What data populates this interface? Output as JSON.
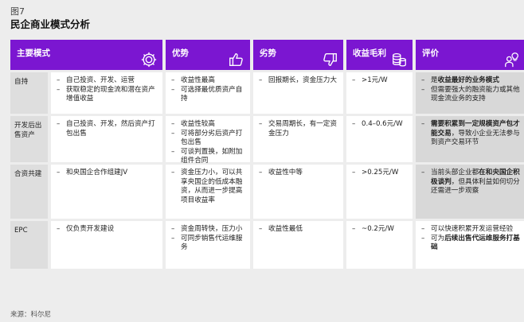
{
  "figure_label": "图7",
  "title": "民企商业模式分析",
  "source": "来源：科尔尼",
  "headers": {
    "mode": "主要模式",
    "pros": "优势",
    "cons": "劣势",
    "margin": "收益毛利",
    "eval": "评价"
  },
  "icons": {
    "mode": "gear-icon",
    "pros": "thumbs-up-icon",
    "cons": "thumbs-down-icon",
    "margin": "coins-icon",
    "eval": "person-idea-icon"
  },
  "colors": {
    "header_bg": "#7b16d1",
    "row_label_bg": "#dedede",
    "cell_bg": "#ffffff",
    "highlight_bg": "#d8d8d8"
  },
  "rows": [
    {
      "label": "自持",
      "mode": [
        "自己投资、开发、运营",
        "获取稳定的现金流和潜在资产增值收益"
      ],
      "pros": [
        "收益性最高",
        "可选择最优质资产自持"
      ],
      "cons": [
        "回报期长，资金压力大"
      ],
      "margin": [
        ">1元/W"
      ],
      "eval_1_pre": "是",
      "eval_1_bold": "收益最好的业务模式",
      "eval_2": "但需要强大的融资能力或其他现金流业务的支持"
    },
    {
      "label": "开发后出售资产",
      "mode": [
        "自己投资、开发，然后资产打包出售"
      ],
      "pros": [
        "收益性较高",
        "可将部分劣后资产打包出售",
        "可谈判置换，如附加组件合同"
      ],
      "cons": [
        "交易周期长，有一定资金压力"
      ],
      "margin": [
        "0.4–0.6元/W"
      ],
      "eval_1_bold": "需要积累到一定规模资产包才能交易",
      "eval_1_post": "，导致小企业无法参与到资产交易环节"
    },
    {
      "label": "合资共建",
      "mode": [
        "和央国企合作组建JV"
      ],
      "pros": [
        "资金压力小，可以共享央国企的低成本融资，从而进一步提高项目收益率"
      ],
      "cons": [
        "收益性中等"
      ],
      "margin": [
        ">0.25元/W"
      ],
      "eval_1_pre": "当前头部企业都",
      "eval_1_bold": "在和央国企积极谈判",
      "eval_1_post": "，但具体利益如何切分还需进一步观察"
    },
    {
      "label": "EPC",
      "mode": [
        "仅负责开发建设"
      ],
      "pros": [
        "资金周转快，压力小",
        "可同步销售代运维服务"
      ],
      "cons": [
        "收益性最低"
      ],
      "margin": [
        "~0.2元/W"
      ],
      "eval_1": "可以快速积累开发运营经验",
      "eval_2_pre": "可为",
      "eval_2_bold": "后续出售代运维服务打基础"
    }
  ]
}
